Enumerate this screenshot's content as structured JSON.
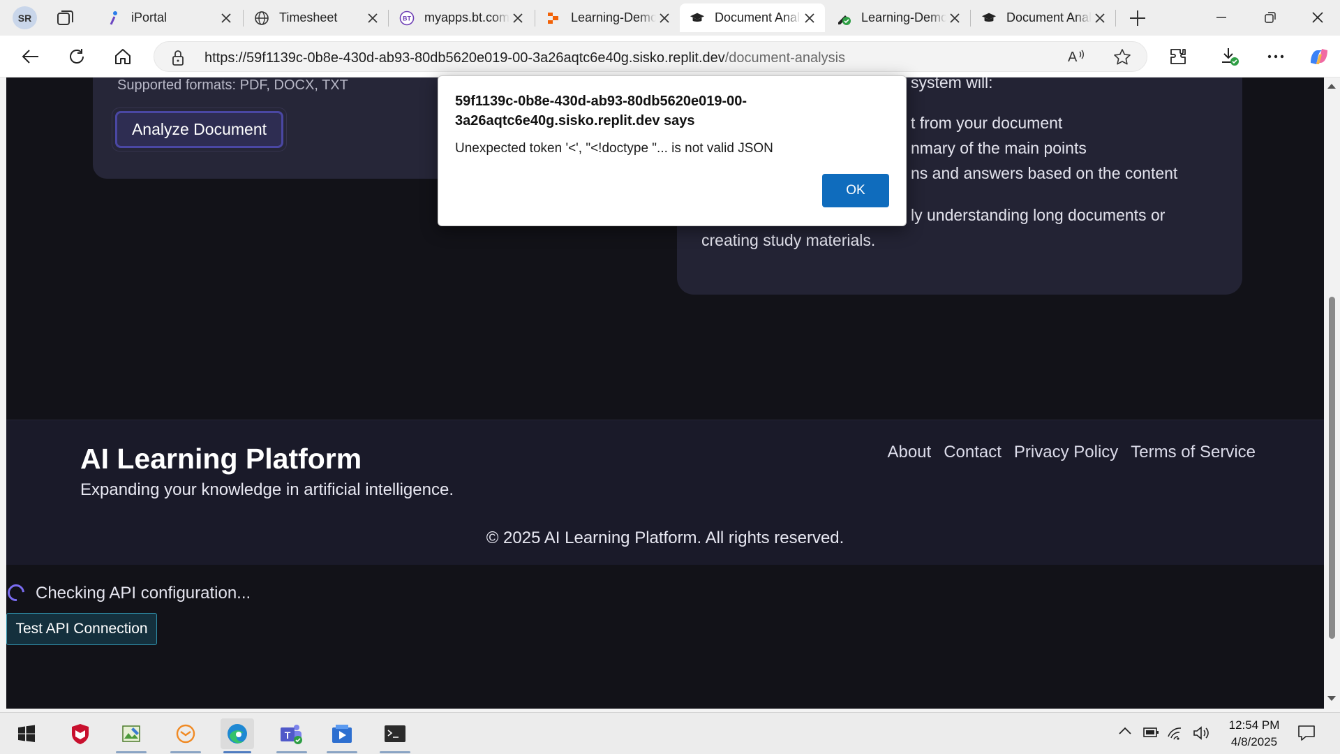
{
  "browser": {
    "profile_initials": "SR",
    "tabs": [
      {
        "title": "iPortal",
        "icon": "iportal-icon"
      },
      {
        "title": "Timesheet",
        "icon": "globe-icon"
      },
      {
        "title": "myapps.bt.com",
        "icon": "bt-icon"
      },
      {
        "title": "Learning-Demo",
        "icon": "replit-icon"
      },
      {
        "title": "Document Analysis",
        "icon": "graduation-cap-icon",
        "active": true
      },
      {
        "title": "Learning-Demo",
        "icon": "check-edit-icon"
      },
      {
        "title": "Document Analysis",
        "icon": "graduation-cap-icon"
      }
    ],
    "url_host": "https://59f1139c-0b8e-430d-ab93-80db5620e019-00-3a26aqtc6e40g.sisko.replit.dev",
    "url_path": "/document-analysis",
    "accent_color": "#0f6cbd"
  },
  "page": {
    "formats": "Supported formats: PDF, DOCX, TXT",
    "analyze_button": "Analyze Document",
    "info_lines": [
      "system will:",
      "t from your document",
      "nmary of the main points",
      "ns and answers based on the content",
      "ly understanding long documents or",
      "creating study materials."
    ],
    "footer": {
      "title": "AI Learning Platform",
      "tagline": "Expanding your knowledge in artificial intelligence.",
      "links": [
        "About",
        "Contact",
        "Privacy Policy",
        "Terms of Service"
      ],
      "copyright": "© 2025 AI Learning Platform. All rights reserved."
    },
    "status_text": "Checking API configuration...",
    "test_button": "Test API Connection"
  },
  "dialog": {
    "origin": "59f1139c-0b8e-430d-ab93-80db5620e019-00-3a26aqtc6e40g.sisko.replit.dev says",
    "message": "Unexpected token '<', \"<!doctype \"... is not valid JSON",
    "ok_label": "OK"
  },
  "taskbar": {
    "time": "12:54 PM",
    "date": "4/8/2025"
  }
}
